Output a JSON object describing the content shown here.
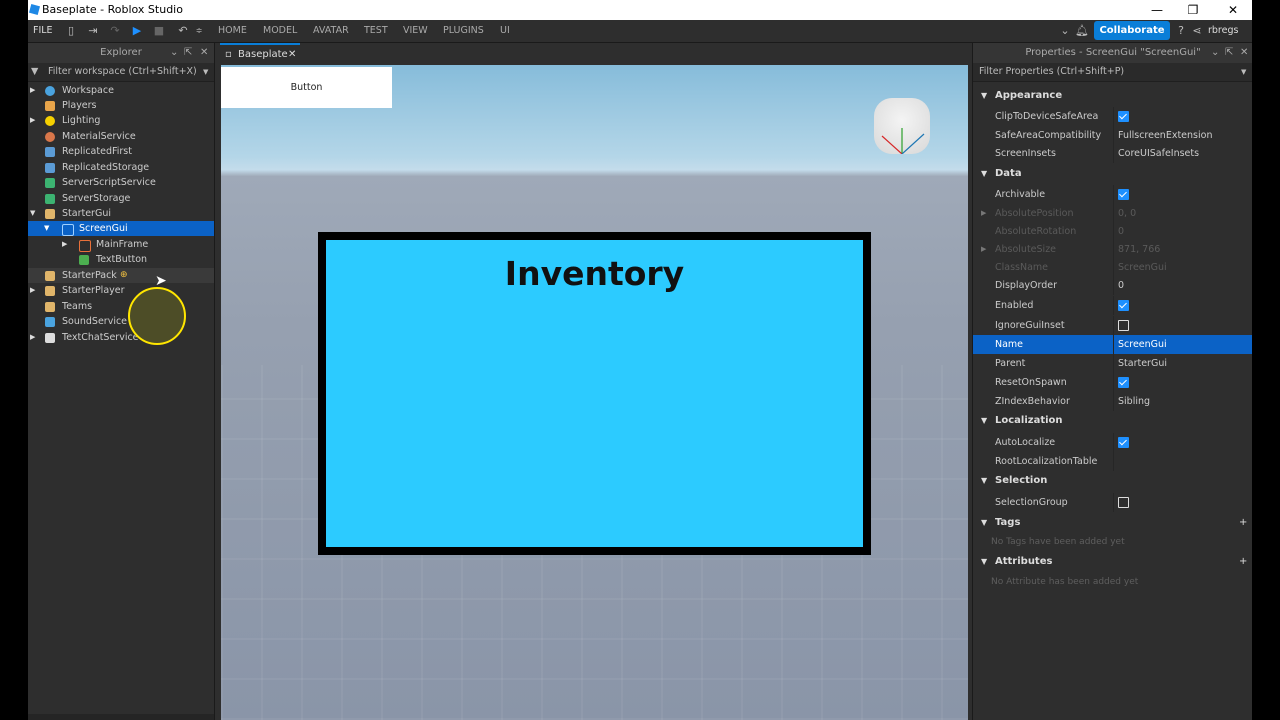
{
  "window": {
    "title": "Baseplate - Roblox Studio"
  },
  "ribbon": {
    "file": "FILE",
    "tabs": [
      "HOME",
      "MODEL",
      "AVATAR",
      "TEST",
      "VIEW",
      "PLUGINS",
      "UI"
    ],
    "collaborate": "Collaborate",
    "user": "rbregs"
  },
  "explorer": {
    "title": "Explorer",
    "filter": "Filter workspace (Ctrl+Shift+X)",
    "items": [
      {
        "label": "Workspace"
      },
      {
        "label": "Players"
      },
      {
        "label": "Lighting"
      },
      {
        "label": "MaterialService"
      },
      {
        "label": "ReplicatedFirst"
      },
      {
        "label": "ReplicatedStorage"
      },
      {
        "label": "ServerScriptService"
      },
      {
        "label": "ServerStorage"
      },
      {
        "label": "StarterGui"
      },
      {
        "label": "ScreenGui"
      },
      {
        "label": "MainFrame"
      },
      {
        "label": "TextButton"
      },
      {
        "label": "StarterPack"
      },
      {
        "label": "StarterPlayer"
      },
      {
        "label": "Teams"
      },
      {
        "label": "SoundService"
      },
      {
        "label": "TextChatService"
      }
    ]
  },
  "viewport": {
    "tab": "Baseplate",
    "button_label": "Button",
    "frame_title": "Inventory"
  },
  "properties": {
    "title": "Properties - ScreenGui \"ScreenGui\"",
    "filter": "Filter Properties (Ctrl+Shift+P)",
    "categories": {
      "appearance": "Appearance",
      "data": "Data",
      "localization": "Localization",
      "selection": "Selection",
      "tags": "Tags",
      "attributes": "Attributes"
    },
    "rows": {
      "clip": {
        "name": "ClipToDeviceSafeArea"
      },
      "safearea": {
        "name": "SafeAreaCompatibility",
        "value": "FullscreenExtension"
      },
      "insets": {
        "name": "ScreenInsets",
        "value": "CoreUISafeInsets"
      },
      "archivable": {
        "name": "Archivable"
      },
      "abspos": {
        "name": "AbsolutePosition",
        "value": "0, 0"
      },
      "absrot": {
        "name": "AbsoluteRotation",
        "value": "0"
      },
      "abssize": {
        "name": "AbsoluteSize",
        "value": "871, 766"
      },
      "classname": {
        "name": "ClassName",
        "value": "ScreenGui"
      },
      "displayorder": {
        "name": "DisplayOrder",
        "value": "0"
      },
      "enabled": {
        "name": "Enabled"
      },
      "ignoreinset": {
        "name": "IgnoreGuiInset"
      },
      "name": {
        "name": "Name",
        "value": "ScreenGui"
      },
      "parent": {
        "name": "Parent",
        "value": "StarterGui"
      },
      "reset": {
        "name": "ResetOnSpawn"
      },
      "zindex": {
        "name": "ZIndexBehavior",
        "value": "Sibling"
      },
      "autoloc": {
        "name": "AutoLocalize"
      },
      "rootloc": {
        "name": "RootLocalizationTable",
        "value": ""
      },
      "selgroup": {
        "name": "SelectionGroup"
      }
    },
    "tags_note": "No Tags have been added yet",
    "attributes_note": "No Attribute has been added yet"
  }
}
